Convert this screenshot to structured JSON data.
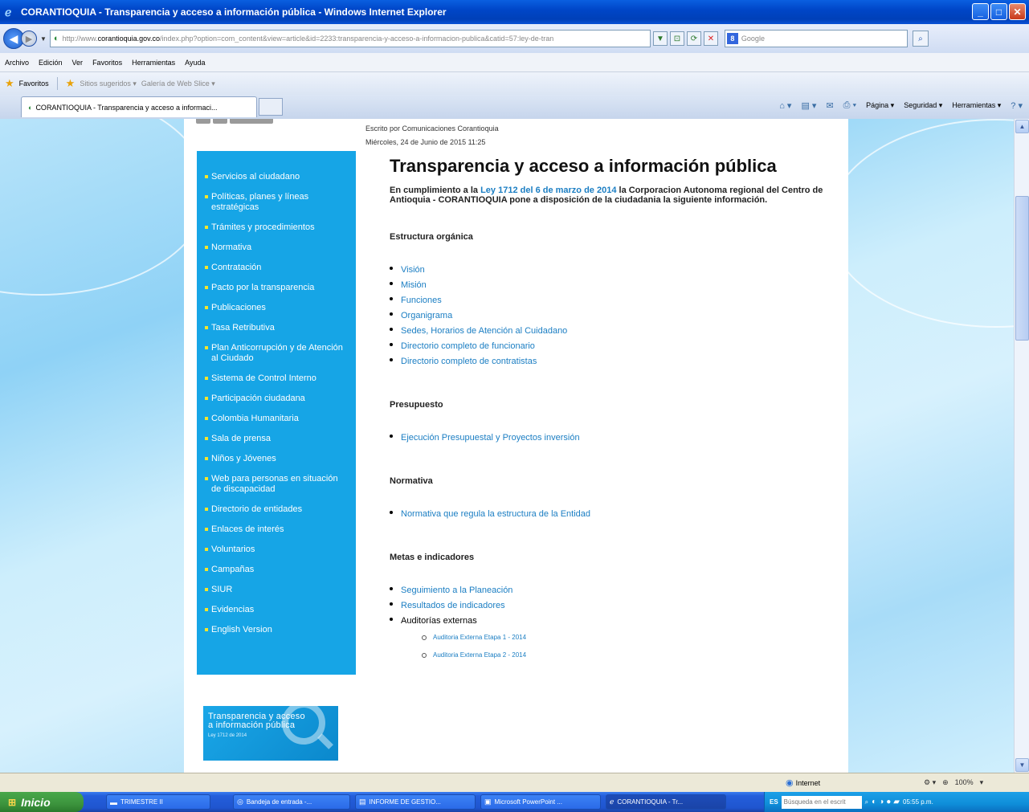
{
  "window": {
    "title": "CORANTIOQUIA - Transparencia y acceso a información pública - Windows Internet Explorer"
  },
  "address": {
    "prefix": "http://www.",
    "domain": "corantioquia.gov.co",
    "path": "/index.php?option=com_content&view=article&id=2233:transparencia-y-acceso-a-informacion-publica&catid=57:ley-de-tran",
    "search_placeholder": "Google"
  },
  "menu": [
    "Archivo",
    "Edición",
    "Ver",
    "Favoritos",
    "Herramientas",
    "Ayuda"
  ],
  "favorites": {
    "label": "Favoritos",
    "items": [
      "Sitios sugeridos ▾",
      "Galería de Web Slice ▾"
    ]
  },
  "tab": {
    "label": "CORANTIOQUIA - Transparencia y acceso a informaci..."
  },
  "commands": [
    "Página ▾",
    "Seguridad ▾",
    "Herramientas ▾"
  ],
  "page": {
    "byline": "Escrito por Comunicaciones Corantioquia",
    "date": "Miércoles, 24 de Junio de 2015 11:25",
    "title": "Transparencia y acceso a información pública",
    "intro_pre": "En cumplimiento a la ",
    "intro_link": "Ley 1712 del 6 de marzo de 2014",
    "intro_post": " la Corporacion Autonoma regional del Centro de Antioquia - CORANTIOQUIA pone a disposición de la ciudadania la siguiente información.",
    "sections": [
      {
        "heading": "Estructura orgánica",
        "links": [
          "Visión",
          "Misión",
          "Funciones",
          "Organigrama",
          "Sedes, Horarios de Atención al Cuidadano",
          "Directorio completo de funcionario",
          "Directorio completo de contratistas"
        ]
      },
      {
        "heading": "Presupuesto",
        "links": [
          "Ejecución Presupuestal y Proyectos inversión"
        ]
      },
      {
        "heading": "Normativa",
        "links": [
          "Normativa que regula la estructura de la Entidad"
        ]
      },
      {
        "heading": "Metas e indicadores",
        "links": [
          "Seguimiento a la Planeación",
          "Resultados de indicadores"
        ],
        "plain": "Auditorías externas",
        "sublinks": [
          "Auditoria Externa Etapa 1 - 2014",
          "Auditoria Externa Etapa 2 - 2014"
        ]
      }
    ]
  },
  "sidebar": {
    "items": [
      "Servicios al ciudadano",
      "Políticas, planes y líneas estratégicas",
      "Trámites y procedimientos",
      "Normativa",
      "Contratación",
      "Pacto por la transparencia",
      "Publicaciones",
      "Tasa Retributiva",
      "Plan Anticorrupción y de Atención al Ciudado",
      "Sistema de Control Interno",
      "Participación ciudadana",
      "Colombia Humanitaria",
      "Sala de prensa",
      "Niños y Jóvenes",
      "Web para personas en situación de discapacidad",
      "Directorio de entidades",
      "Enlaces de interés",
      "Voluntarios",
      "Campañas",
      "SIUR",
      "Evidencias",
      "English Version"
    ],
    "banner_line1": "Transparencia y acceso",
    "banner_line2": "a información pública",
    "banner_sub": "Ley 1712 de 2014"
  },
  "status": {
    "zone": "Internet",
    "zoom": "100%"
  },
  "taskbar": {
    "start": "Inicio",
    "tasks": [
      "TRIMESTRE II",
      "Bandeja de entrada -...",
      "INFORME DE GESTIO...",
      "Microsoft PowerPoint ...",
      "CORANTIOQUIA - Tr..."
    ],
    "lang": "ES",
    "search": "Búsqueda en el escrit",
    "clock": "05:55 p.m."
  }
}
